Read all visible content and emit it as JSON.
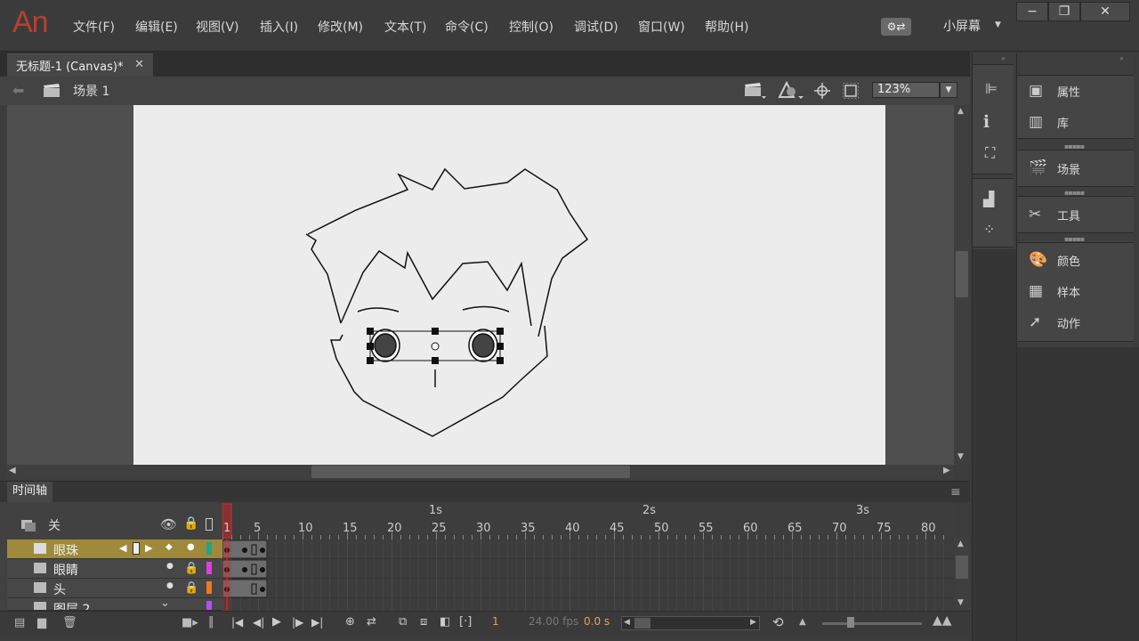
{
  "app": {
    "logo": "An",
    "menu": [
      "文件(F)",
      "编辑(E)",
      "视图(V)",
      "插入(I)",
      "修改(M)",
      "文本(T)",
      "命令(C)",
      "控制(O)",
      "调试(D)",
      "窗口(W)",
      "帮助(H)"
    ],
    "workspace": "小屏幕"
  },
  "document": {
    "tab_title": "无标题-1 (Canvas)*",
    "scene": "场景 1",
    "zoom": "123%"
  },
  "timeline": {
    "tab": "时间轴",
    "header_toggle": "关",
    "layers": [
      {
        "name": "眼珠",
        "color": "#1aa68a",
        "selected": true
      },
      {
        "name": "眼睛",
        "color": "#e040e0",
        "selected": false
      },
      {
        "name": "头",
        "color": "#f07820",
        "selected": false
      },
      {
        "name": "图层 2",
        "color": "#b050ff",
        "selected": false
      }
    ],
    "seconds": [
      "1s",
      "2s",
      "3s"
    ],
    "ruler": [
      "1",
      "5",
      "10",
      "15",
      "20",
      "25",
      "30",
      "35",
      "40",
      "45",
      "50",
      "55",
      "60",
      "65",
      "70",
      "75",
      "80"
    ],
    "current_frame": "1",
    "fps": "24.00 fps",
    "time": "0.0 s"
  },
  "panels": {
    "items": [
      "属性",
      "库",
      "场景",
      "工具",
      "颜色",
      "样本",
      "动作"
    ]
  }
}
